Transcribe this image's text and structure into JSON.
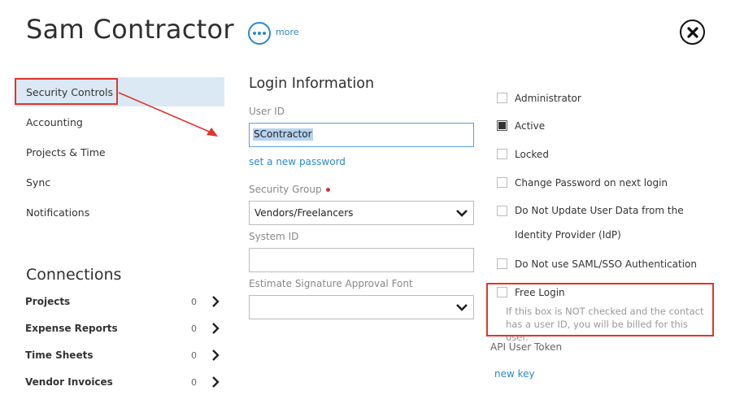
{
  "header": {
    "title": "Sam Contractor",
    "more_label": "more"
  },
  "sidebar": {
    "items": [
      {
        "label": "Security Controls",
        "active": true
      },
      {
        "label": "Accounting"
      },
      {
        "label": "Projects & Time"
      },
      {
        "label": "Sync"
      },
      {
        "label": "Notifications"
      }
    ]
  },
  "connections": {
    "title": "Connections",
    "rows": [
      {
        "label": "Projects",
        "count": "0"
      },
      {
        "label": "Expense Reports",
        "count": "0"
      },
      {
        "label": "Time Sheets",
        "count": "0"
      },
      {
        "label": "Vendor Invoices",
        "count": "0"
      }
    ]
  },
  "login": {
    "section_title": "Login Information",
    "user_id_label": "User ID",
    "user_id_value": "SContractor",
    "set_password_link": "set a new password",
    "security_group_label": "Security Group",
    "security_group_value": "Vendors/Freelancers",
    "system_id_label": "System ID",
    "system_id_value": "",
    "signature_font_label": "Estimate Signature Approval Font",
    "signature_font_value": ""
  },
  "flags": {
    "administrator": {
      "label": "Administrator",
      "checked": false
    },
    "active": {
      "label": "Active",
      "checked": true
    },
    "locked": {
      "label": "Locked",
      "checked": false
    },
    "change_password": {
      "label": "Change Password on next login",
      "checked": false
    },
    "no_update_idp": {
      "label": "Do Not Update User Data from the Identity Provider (IdP)",
      "checked": false
    },
    "no_saml": {
      "label": "Do Not use SAML/SSO Authentication",
      "checked": false
    },
    "free_login": {
      "label": "Free Login",
      "checked": false,
      "note": "If this box is NOT checked and the contact has a user ID, you will be billed for this user."
    }
  },
  "api": {
    "label": "API User Token",
    "new_key_link": "new key"
  },
  "colors": {
    "accent": "#2a8ac9",
    "annotation_red": "#e0352b",
    "active_bg": "#dbe9f4"
  }
}
